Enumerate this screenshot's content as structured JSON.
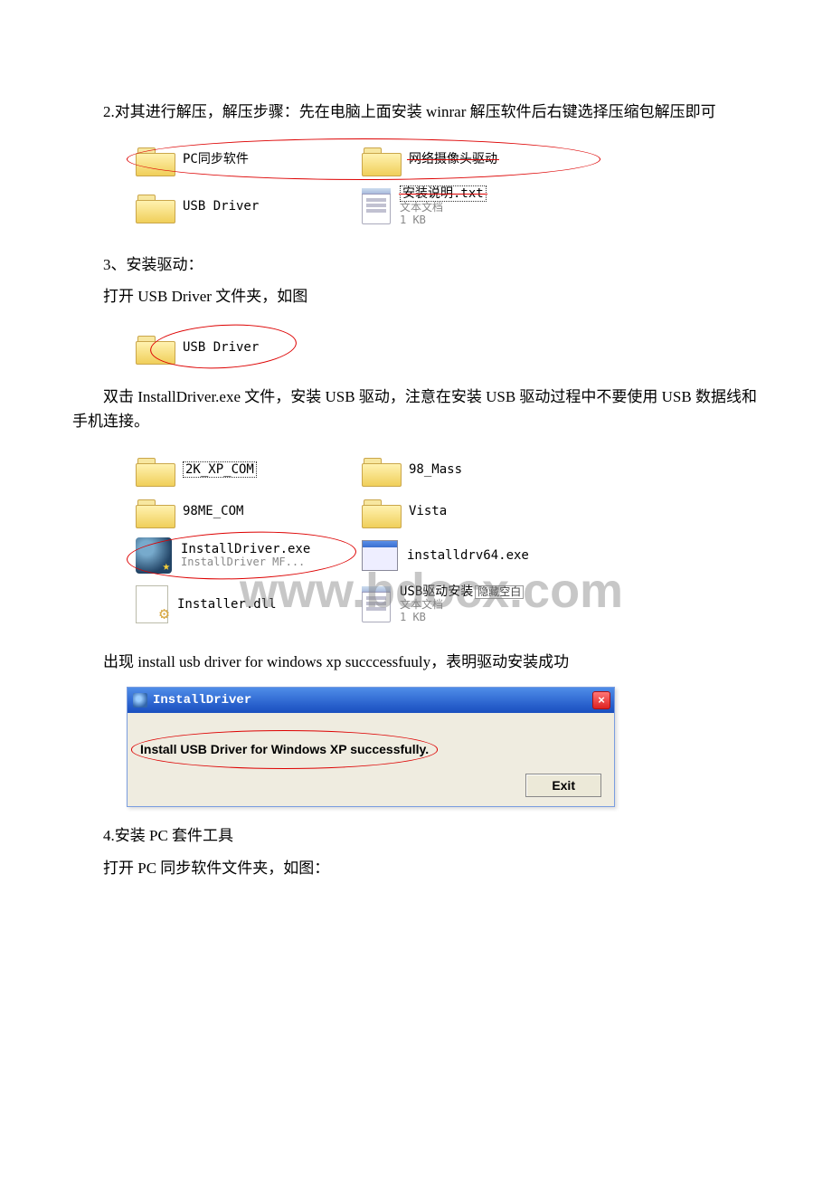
{
  "watermark": "www.bdocx.com",
  "text": {
    "p1": "2.对其进行解压，解压步骤：先在电脑上面安装 winrar 解压软件后右键选择压缩包解压即可",
    "p2": "3、安装驱动：",
    "p3": "打开 USB Driver 文件夹，如图",
    "p4": "双击 InstallDriver.exe 文件，安装 USB 驱动，注意在安装 USB 驱动过程中不要使用 USB 数据线和手机连接。",
    "p5": "出现 install usb driver for windows xp succcessfuuly，表明驱动安装成功",
    "p6": "4.安装 PC 套件工具",
    "p7": "打开 PC 同步软件文件夹，如图："
  },
  "panel1": {
    "items": [
      {
        "label": "PC同步软件"
      },
      {
        "label": "网络摄像头驱动"
      },
      {
        "label": "USB Driver"
      },
      {
        "label": "安装说明.txt",
        "sub1": "文本文档",
        "sub2": "1 KB"
      }
    ]
  },
  "singleFolder": {
    "label": "USB Driver"
  },
  "panel2": {
    "items": [
      {
        "label": "2K_XP_COM"
      },
      {
        "label": "98_Mass"
      },
      {
        "label": "98ME_COM"
      },
      {
        "label": "Vista"
      },
      {
        "label": "InstallDriver.exe",
        "sub1": "InstallDriver MF..."
      },
      {
        "label": "installdrv64.exe"
      },
      {
        "label": "Installer.dll"
      },
      {
        "label": "USB驱动安装",
        "float": "隐藏空白",
        "sub1": "文本文档",
        "sub2": "1 KB"
      }
    ]
  },
  "dialog": {
    "title": "InstallDriver",
    "message": "Install USB Driver for Windows XP successfully.",
    "exit": "Exit"
  }
}
